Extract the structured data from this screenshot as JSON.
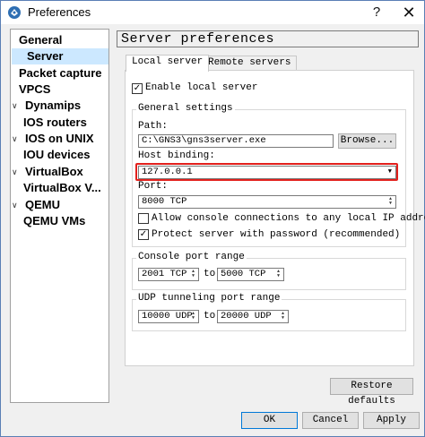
{
  "window": {
    "title": "Preferences",
    "help_glyph": "?",
    "close_glyph": "✕"
  },
  "sidebar": {
    "items": [
      {
        "label": "General",
        "level": 0,
        "expanded": null,
        "selected": false
      },
      {
        "label": "Server",
        "level": 0,
        "expanded": null,
        "selected": true
      },
      {
        "label": "Packet capture",
        "level": 0,
        "expanded": null,
        "selected": false
      },
      {
        "label": "VPCS",
        "level": 0,
        "expanded": null,
        "selected": false
      },
      {
        "label": "Dynamips",
        "level": 1,
        "expanded": true,
        "selected": false
      },
      {
        "label": "IOS routers",
        "level": 2,
        "expanded": null,
        "selected": false
      },
      {
        "label": "IOS on UNIX",
        "level": 1,
        "expanded": true,
        "selected": false
      },
      {
        "label": "IOU devices",
        "level": 2,
        "expanded": null,
        "selected": false
      },
      {
        "label": "VirtualBox",
        "level": 1,
        "expanded": true,
        "selected": false
      },
      {
        "label": "VirtualBox V...",
        "level": 2,
        "expanded": null,
        "selected": false
      },
      {
        "label": "QEMU",
        "level": 1,
        "expanded": true,
        "selected": false
      },
      {
        "label": "QEMU VMs",
        "level": 2,
        "expanded": null,
        "selected": false
      }
    ],
    "expand_glyph": "∨"
  },
  "panel": {
    "title": "Server preferences",
    "tabs": [
      {
        "label": "Local server",
        "active": true
      },
      {
        "label": "Remote servers",
        "active": false
      }
    ],
    "enable_local_server": {
      "label": "Enable local server",
      "checked": true
    },
    "general_settings": {
      "title": "General settings",
      "path_label": "Path:",
      "path_value": "C:\\GNS3\\gns3server.exe",
      "browse_label": "Browse...",
      "host_binding_label": "Host binding:",
      "host_binding_value": "127.0.0.1",
      "port_label": "Port:",
      "port_value": "8000 TCP",
      "allow_console_label": "Allow console connections to any local IP address",
      "allow_console_checked": false,
      "protect_label": "Protect server with password (recommended)",
      "protect_checked": true
    },
    "console_port_range": {
      "title": "Console port range",
      "from": "2001 TCP",
      "to_label": "to",
      "to": "5000 TCP"
    },
    "udp_port_range": {
      "title": "UDP tunneling port range",
      "from": "10000 UDP",
      "to_label": "to",
      "to": "20000 UDP"
    },
    "restore_defaults_label": "Restore defaults"
  },
  "footer": {
    "ok_label": "OK",
    "cancel_label": "Cancel",
    "apply_label": "Apply"
  },
  "colors": {
    "selection": "#cce8ff",
    "highlight_box": "#e2201c",
    "window_border": "#5a7fb5"
  }
}
